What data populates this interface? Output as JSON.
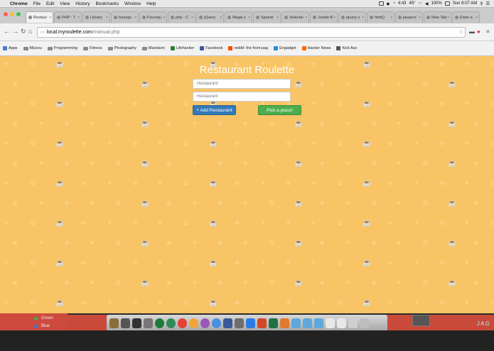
{
  "menubar": {
    "app_name": "Chrome",
    "items": [
      "File",
      "Edit",
      "View",
      "History",
      "Bookmarks",
      "Window",
      "Help"
    ],
    "status_time": "4:43",
    "status_temp": "45°",
    "battery": "100%",
    "clock": "Sun 8:07 AM"
  },
  "tabs": [
    {
      "label": "Restaur"
    },
    {
      "label": "PHP : T"
    },
    {
      "label": "Library"
    },
    {
      "label": "foursqu"
    },
    {
      "label": "Foursqu"
    },
    {
      "label": "php - C"
    },
    {
      "label": "jQuery"
    },
    {
      "label": "Illegal s"
    },
    {
      "label": "Speedr"
    },
    {
      "label": "Selectal"
    },
    {
      "label": "Josiah B"
    },
    {
      "label": "jquery s"
    },
    {
      "label": "html()"
    },
    {
      "label": "javascri"
    },
    {
      "label": "New Tab"
    },
    {
      "label": "Enter a"
    }
  ],
  "omnibox": {
    "host": "local.myroulette.com",
    "path": "/manual.php"
  },
  "bookmarks": [
    {
      "label": "Apps",
      "kind": "apps"
    },
    {
      "label": "Mizzou",
      "kind": "folder"
    },
    {
      "label": "Programming",
      "kind": "folder"
    },
    {
      "label": "Fitness",
      "kind": "folder"
    },
    {
      "label": "Photography",
      "kind": "folder"
    },
    {
      "label": "Mandarin",
      "kind": "folder"
    },
    {
      "label": "Lifehacker",
      "kind": "site"
    },
    {
      "label": "Facebook",
      "kind": "site"
    },
    {
      "label": "reddit: the front pag",
      "kind": "site"
    },
    {
      "label": "Engadget",
      "kind": "site"
    },
    {
      "label": "Hacker News",
      "kind": "site"
    },
    {
      "label": "Kick Ass",
      "kind": "site"
    }
  ],
  "page": {
    "title": "Restaurant Roulette",
    "field1_placeholder": "Restaurant",
    "field2_placeholder": "Restaurant",
    "add_button": "+ Add Restaurant",
    "pick_button": "Pick a place!"
  },
  "desktop": {
    "tags": [
      {
        "label": "Green",
        "color": "#3cb44b"
      },
      {
        "label": "Blue",
        "color": "#3a7bd5"
      }
    ],
    "corner_logo": "JAG"
  },
  "colors": {
    "page_bg": "#f8c466",
    "add_button": "#337ab7",
    "pick_button": "#4cae4c"
  }
}
